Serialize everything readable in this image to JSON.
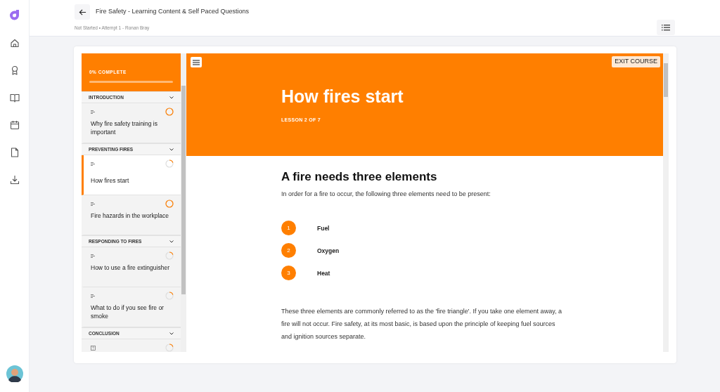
{
  "header": {
    "title": "Fire Safety - Learning Content & Self Paced Questions",
    "subtitle": "Not Started • Attempt 1 - Ronan Bray"
  },
  "rail": {
    "items": [
      {
        "kind": "home"
      },
      {
        "kind": "award"
      },
      {
        "kind": "book"
      },
      {
        "kind": "calendar"
      },
      {
        "kind": "file"
      },
      {
        "kind": "download"
      }
    ]
  },
  "outline": {
    "progress_label": "0% COMPLETE",
    "level": 0,
    "sections": [
      {
        "title": "INTRODUCTION",
        "expanded": true,
        "lessons": [
          {
            "kind": "text",
            "title": "Why fire safety training is important",
            "selected": false,
            "started": true
          }
        ]
      },
      {
        "title": "PREVENTING FIRES",
        "expanded": true,
        "lessons": [
          {
            "kind": "text",
            "title": "How fires start",
            "selected": true,
            "started": false
          },
          {
            "kind": "text",
            "title": "Fire hazards in the workplace",
            "selected": false,
            "started": true
          }
        ]
      },
      {
        "title": "RESPONDING TO FIRES",
        "expanded": true,
        "lessons": [
          {
            "kind": "text",
            "title": "How to use a fire extinguisher",
            "selected": false,
            "started": false
          },
          {
            "kind": "text",
            "title": "What to do if you see fire or smoke",
            "selected": false,
            "started": false
          }
        ]
      },
      {
        "title": "CONCLUSION",
        "expanded": true,
        "lessons": [
          {
            "kind": "quiz",
            "selected": false,
            "started": false
          }
        ]
      }
    ]
  },
  "lesson": {
    "exit_label": "EXIT COURSE",
    "title": "How fires start",
    "counter": "LESSON 2 OF 7",
    "heading": "A fire needs three elements",
    "intro": "In order for a fire to occur, the following three elements need to be present:",
    "elements": [
      {
        "number": "1",
        "label": "Fuel"
      },
      {
        "number": "2",
        "label": "Oxygen"
      },
      {
        "number": "3",
        "label": "Heat"
      }
    ],
    "paragraph": "These three elements are commonly referred to as the 'fire triangle'. If you take one element away, a fire will not occur. Fire safety, at its most basic, is based upon the principle of keeping fuel sources and ignition sources separate."
  }
}
